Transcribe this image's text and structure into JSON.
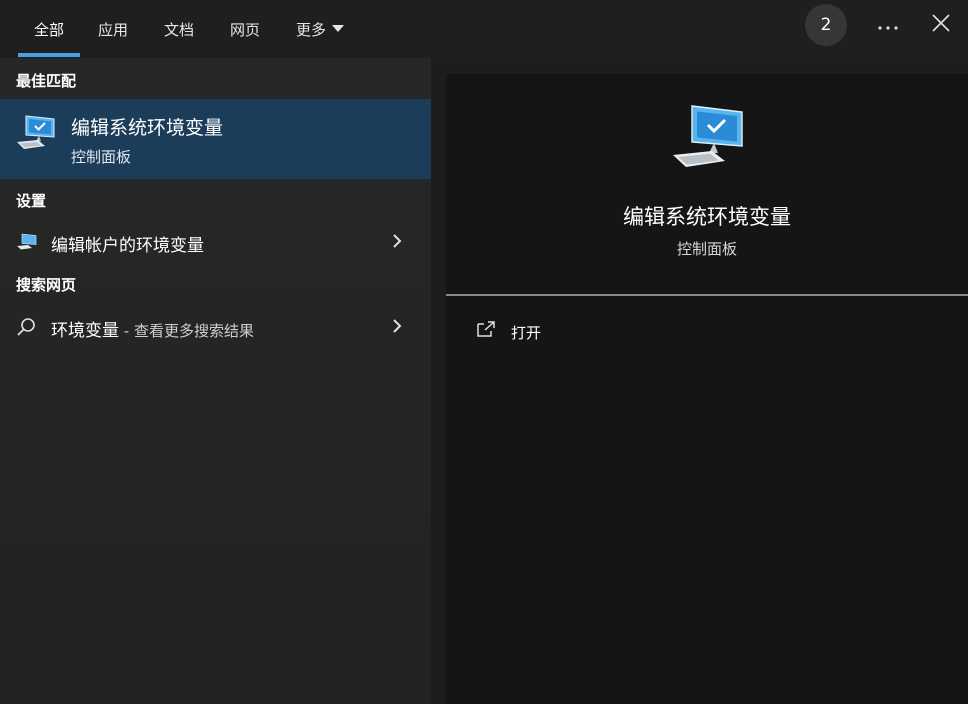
{
  "tabs": [
    {
      "label": "全部",
      "active": true
    },
    {
      "label": "应用"
    },
    {
      "label": "文档"
    },
    {
      "label": "网页"
    },
    {
      "label": "更多"
    }
  ],
  "header": {
    "badge_count": "2",
    "more_icon": "ellipsis-icon",
    "close_icon": "close-icon"
  },
  "best_match": {
    "section_title": "最佳匹配",
    "name": "编辑系统环境变量",
    "subtitle": "控制面板",
    "icon": "system-properties-monitor-icon"
  },
  "settings": {
    "section_title": "设置",
    "item_label": "编辑帐户的环境变量",
    "icon": "system-monitor-icon"
  },
  "web_search": {
    "section_title": "搜索网页",
    "query": "环境变量",
    "suffix": " - 查看更多搜索结果",
    "icon": "search-icon"
  },
  "preview": {
    "title": "编辑系统环境变量",
    "subtitle": "控制面板",
    "actions": [
      {
        "label": "打开",
        "icon": "open-external-icon"
      }
    ]
  },
  "colors": {
    "accent": "#4aa0e6",
    "selected_bg": "#1c3d5a",
    "panel_bg": "#151515"
  }
}
